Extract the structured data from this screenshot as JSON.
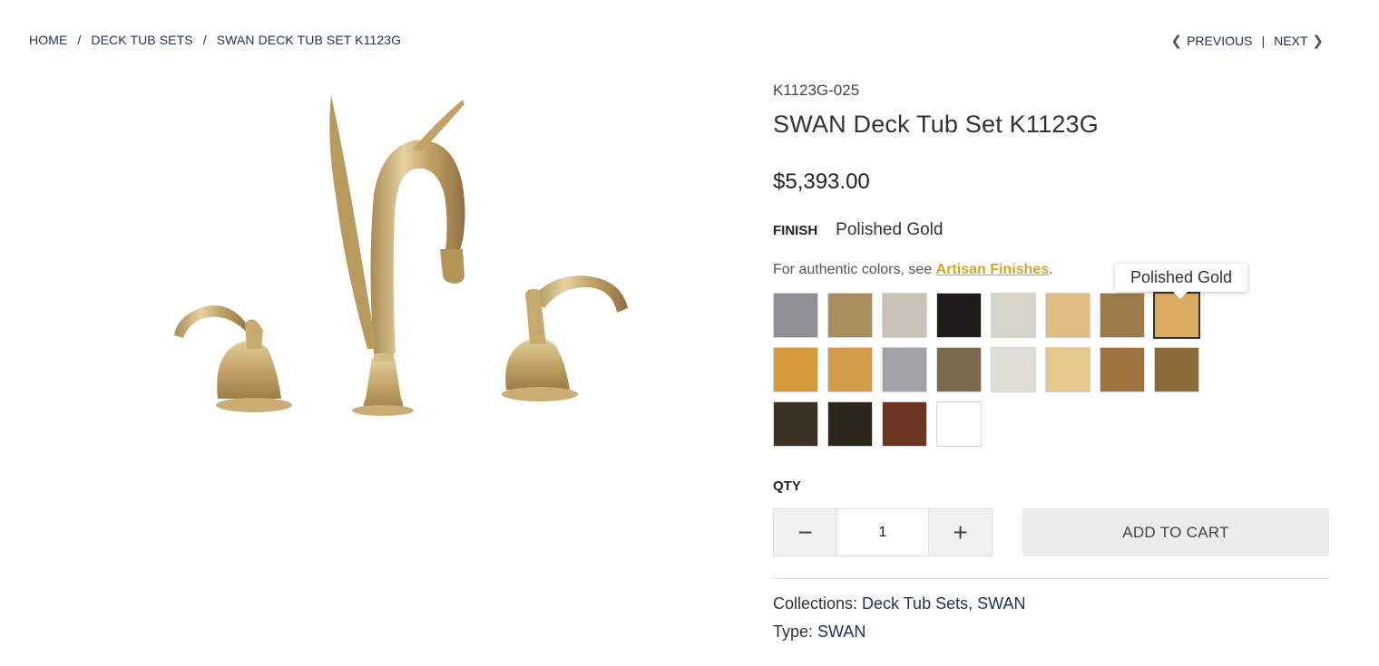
{
  "breadcrumb": {
    "home": "HOME",
    "sep1": "/",
    "category": "DECK TUB SETS",
    "sep2": "/",
    "current": "SWAN DECK TUB SET K1123G"
  },
  "pager": {
    "previous": "PREVIOUS",
    "separator": "|",
    "next": "NEXT"
  },
  "product": {
    "sku": "K1123G-025",
    "title": "SWAN Deck Tub Set K1123G",
    "price": "$5,393.00",
    "finish_label": "FINISH",
    "finish_value": "Polished Gold",
    "note_prefix": "For authentic colors, see ",
    "note_link": "Artisan Finishes",
    "note_suffix": "."
  },
  "swatches": [
    {
      "color": "#8f9094",
      "selected": false
    },
    {
      "color": "#a88d5f",
      "selected": false
    },
    {
      "color": "#c9c2b8",
      "selected": false
    },
    {
      "color": "#1c1b17",
      "selected": false
    },
    {
      "color": "#d6d5cc",
      "selected": false
    },
    {
      "color": "#e0bd84",
      "selected": false
    },
    {
      "color": "#9c7a47",
      "selected": false
    },
    {
      "color": "#dcab62",
      "selected": true
    },
    {
      "color": "#d59a3c",
      "selected": false
    },
    {
      "color": "#d49a4c",
      "selected": false
    },
    {
      "color": "#a2a2a4",
      "selected": false
    },
    {
      "color": "#7b6a51",
      "selected": false
    },
    {
      "color": "#deddd3",
      "selected": false
    },
    {
      "color": "#e5c88c",
      "selected": false
    },
    {
      "color": "#9d7440",
      "selected": false
    },
    {
      "color": "#8c6a35",
      "selected": false
    },
    {
      "color": "#3a3124",
      "selected": false
    },
    {
      "color": "#2b261d",
      "selected": false
    },
    {
      "color": "#6b3421",
      "selected": false
    },
    {
      "color": "#ffffff",
      "selected": false
    }
  ],
  "tooltip": "Polished Gold",
  "qty": {
    "label": "QTY",
    "minus": "−",
    "value": "1",
    "plus": "+"
  },
  "add_to_cart": "ADD TO CART",
  "meta": {
    "collections_label": "Collections: ",
    "collection_1": "Deck Tub Sets",
    "collection_sep": ", ",
    "collection_2": "SWAN",
    "type_label": "Type: ",
    "type_value": "SWAN"
  }
}
